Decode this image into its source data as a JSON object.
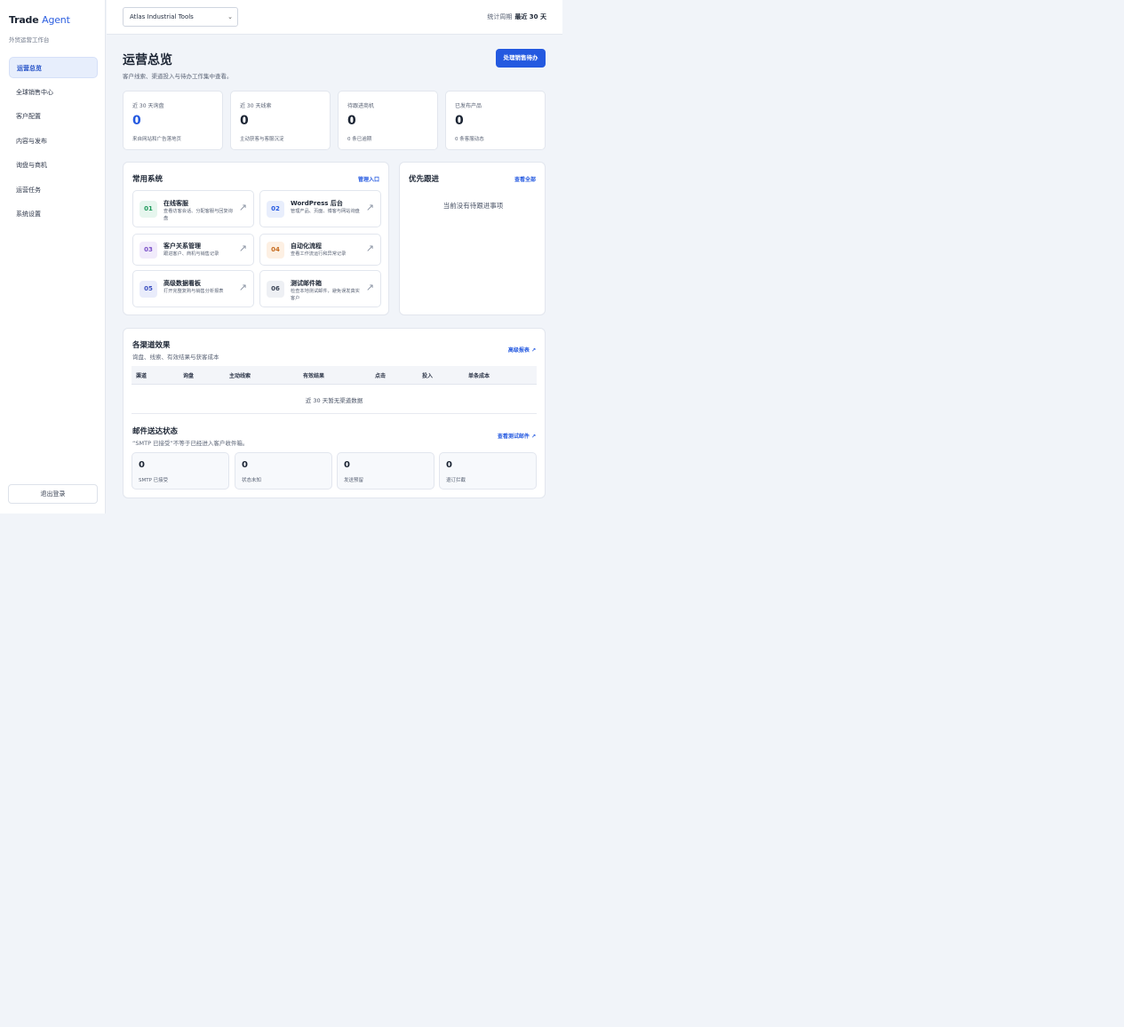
{
  "sidebar": {
    "brand_main": "Trade",
    "brand_accent": "Agent",
    "brand_sub": "外贸运营工作台",
    "items": [
      {
        "label": "运营总览",
        "active": true
      },
      {
        "label": "全球销售中心"
      },
      {
        "label": "客户配置"
      },
      {
        "label": "内容与发布"
      },
      {
        "label": "询盘与商机"
      },
      {
        "label": "运营任务"
      },
      {
        "label": "系统设置"
      }
    ],
    "logout_label": "退出登录"
  },
  "topbar": {
    "site_select": "Atlas Industrial Tools",
    "period_label": "统计周期",
    "period_value": "最近 30 天"
  },
  "page": {
    "title": "运营总览",
    "subtitle": "客户线索、渠道投入与待办工作集中查看。",
    "primary_button": "处理销售待办"
  },
  "stats": [
    {
      "label": "近 30 天询盘",
      "value": "0",
      "sub": "来自网站和广告落地页"
    },
    {
      "label": "近 30 天线索",
      "value": "0",
      "sub": "主动获客与客服沉淀"
    },
    {
      "label": "待跟进商机",
      "value": "0",
      "sub": "0 条已逾期"
    },
    {
      "label": "已发布产品",
      "value": "0",
      "sub": "0 条客服动态"
    }
  ],
  "systems": {
    "title": "常用系统",
    "link": "管理入口",
    "items": [
      {
        "num": "01",
        "name": "在线客服",
        "desc": "查看访客会话、分配客服与回复询盘"
      },
      {
        "num": "02",
        "name": "WordPress 后台",
        "desc": "管理产品、页面、博客与网站询盘"
      },
      {
        "num": "03",
        "name": "客户关系管理",
        "desc": "跟进客户、商机与销售记录"
      },
      {
        "num": "04",
        "name": "自动化流程",
        "desc": "查看工作流运行和异常记录"
      },
      {
        "num": "05",
        "name": "高级数据看板",
        "desc": "打开完整复购与销售分析报表"
      },
      {
        "num": "06",
        "name": "测试邮件箱",
        "desc": "检查本地测试邮件，避免误发真实客户"
      }
    ]
  },
  "priority": {
    "title": "优先跟进",
    "link": "查看全部",
    "empty": "当前没有待跟进事项"
  },
  "channels": {
    "title": "各渠道效果",
    "subtitle": "询盘、线索、有效结果与获客成本",
    "link": "高级报表 ↗",
    "columns": [
      "渠道",
      "询盘",
      "主动线索",
      "有效结果",
      "点击",
      "投入",
      "单条成本"
    ],
    "empty": "近 30 天暂无渠道数据"
  },
  "mail": {
    "title": "邮件送达状态",
    "subtitle": "“SMTP 已接受”不等于已经进入客户收件箱。",
    "link": "查看测试邮件 ↗",
    "items": [
      {
        "value": "0",
        "label": "SMTP 已接受"
      },
      {
        "value": "0",
        "label": "状态未知"
      },
      {
        "value": "0",
        "label": "发送预留"
      },
      {
        "value": "0",
        "label": "退订拦截"
      }
    ]
  },
  "colors": {
    "accent": "#2459e0",
    "num_green_bg": "#e6f6ee",
    "num_green": "#1f9a5b",
    "num_blue_bg": "#e8eefc",
    "num_blue": "#2459e0",
    "num_purple_bg": "#f1ebfb",
    "num_purple": "#7a4fc8",
    "num_orange_bg": "#fdf0e3",
    "num_orange": "#c66a1d",
    "num_indigo_bg": "#e9ecfb",
    "num_indigo": "#3b4fc0",
    "num_gray_bg": "#eef0f4",
    "num_gray": "#3a4354"
  }
}
